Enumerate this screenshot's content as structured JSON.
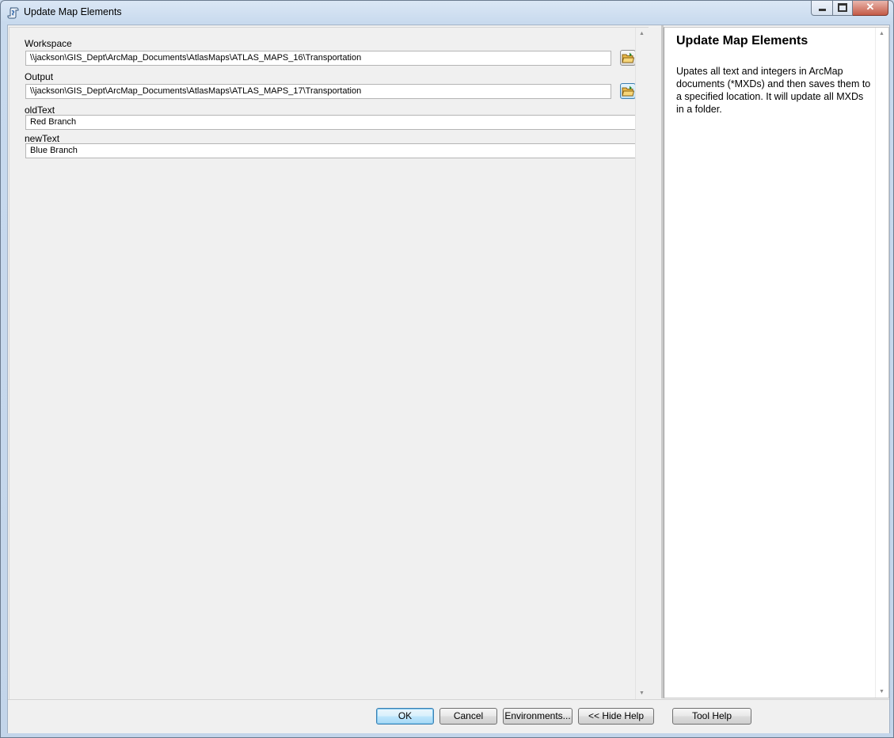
{
  "window": {
    "title": "Update Map Elements",
    "icon": "script-tool-icon"
  },
  "params": {
    "workspace": {
      "label": "Workspace",
      "value": "\\\\jackson\\GIS_Dept\\ArcMap_Documents\\AtlasMaps\\ATLAS_MAPS_16\\Transportation"
    },
    "output": {
      "label": "Output",
      "value": "\\\\jackson\\GIS_Dept\\ArcMap_Documents\\AtlasMaps\\ATLAS_MAPS_17\\Transportation"
    },
    "old_text": {
      "label": "oldText",
      "value": "Red Branch"
    },
    "new_text": {
      "label": "newText",
      "value": "Blue Branch"
    }
  },
  "help": {
    "title": "Update Map Elements",
    "body": "Upates all text and integers in ArcMap documents (*MXDs) and then saves them to a specified location. It will update all MXDs in a folder."
  },
  "buttons": {
    "ok": "OK",
    "cancel": "Cancel",
    "environments": "Environments...",
    "hide_help": "<< Hide Help",
    "tool_help": "Tool Help"
  }
}
